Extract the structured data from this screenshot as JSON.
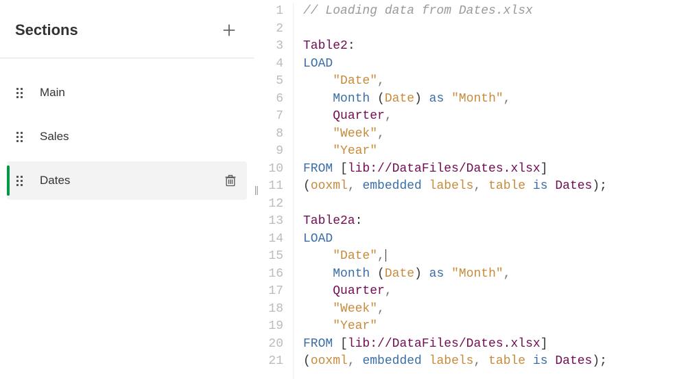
{
  "sidebar": {
    "title": "Sections",
    "items": [
      {
        "label": "Main",
        "active": false
      },
      {
        "label": "Sales",
        "active": false
      },
      {
        "label": "Dates",
        "active": true
      }
    ]
  },
  "editor": {
    "lines": [
      {
        "n": 1,
        "tokens": [
          {
            "t": "// Loading data from Dates.xlsx",
            "c": "c-comment"
          }
        ]
      },
      {
        "n": 2,
        "tokens": []
      },
      {
        "n": 3,
        "tokens": [
          {
            "t": "Table2",
            "c": "c-ident"
          },
          {
            "t": ":",
            "c": "c-black"
          }
        ]
      },
      {
        "n": 4,
        "tokens": [
          {
            "t": "LOAD",
            "c": "c-key"
          }
        ]
      },
      {
        "n": 5,
        "tokens": [
          {
            "t": "    ",
            "c": ""
          },
          {
            "t": "\"Date\"",
            "c": "c-str"
          },
          {
            "t": ",",
            "c": "c-punc"
          }
        ]
      },
      {
        "n": 6,
        "tokens": [
          {
            "t": "    ",
            "c": ""
          },
          {
            "t": "Month",
            "c": "c-key"
          },
          {
            "t": " (",
            "c": "c-black"
          },
          {
            "t": "Date",
            "c": "c-str"
          },
          {
            "t": ") ",
            "c": "c-black"
          },
          {
            "t": "as",
            "c": "c-key"
          },
          {
            "t": " ",
            "c": ""
          },
          {
            "t": "\"Month\"",
            "c": "c-str"
          },
          {
            "t": ",",
            "c": "c-punc"
          }
        ]
      },
      {
        "n": 7,
        "tokens": [
          {
            "t": "    ",
            "c": ""
          },
          {
            "t": "Quarter",
            "c": "c-ident"
          },
          {
            "t": ",",
            "c": "c-punc"
          }
        ]
      },
      {
        "n": 8,
        "tokens": [
          {
            "t": "    ",
            "c": ""
          },
          {
            "t": "\"Week\"",
            "c": "c-str"
          },
          {
            "t": ",",
            "c": "c-punc"
          }
        ]
      },
      {
        "n": 9,
        "tokens": [
          {
            "t": "    ",
            "c": ""
          },
          {
            "t": "\"Year\"",
            "c": "c-str"
          }
        ]
      },
      {
        "n": 10,
        "tokens": [
          {
            "t": "FROM",
            "c": "c-key"
          },
          {
            "t": " [",
            "c": "c-black"
          },
          {
            "t": "lib://DataFiles/Dates.xlsx",
            "c": "c-ident"
          },
          {
            "t": "]",
            "c": "c-black"
          }
        ]
      },
      {
        "n": 11,
        "tokens": [
          {
            "t": "(",
            "c": "c-black"
          },
          {
            "t": "ooxml",
            "c": "c-str"
          },
          {
            "t": ", ",
            "c": "c-punc"
          },
          {
            "t": "embedded",
            "c": "c-key"
          },
          {
            "t": " ",
            "c": ""
          },
          {
            "t": "labels",
            "c": "c-str"
          },
          {
            "t": ", ",
            "c": "c-punc"
          },
          {
            "t": "table",
            "c": "c-str"
          },
          {
            "t": " ",
            "c": ""
          },
          {
            "t": "is",
            "c": "c-key"
          },
          {
            "t": " ",
            "c": ""
          },
          {
            "t": "Dates",
            "c": "c-ident"
          },
          {
            "t": ");",
            "c": "c-black"
          }
        ]
      },
      {
        "n": 12,
        "tokens": []
      },
      {
        "n": 13,
        "tokens": [
          {
            "t": "Table2a",
            "c": "c-ident"
          },
          {
            "t": ":",
            "c": "c-black"
          }
        ]
      },
      {
        "n": 14,
        "tokens": [
          {
            "t": "LOAD",
            "c": "c-key"
          }
        ]
      },
      {
        "n": 15,
        "tokens": [
          {
            "t": "    ",
            "c": ""
          },
          {
            "t": "\"Date\"",
            "c": "c-str"
          },
          {
            "t": ",",
            "c": "c-punc",
            "cursor": true
          }
        ]
      },
      {
        "n": 16,
        "tokens": [
          {
            "t": "    ",
            "c": ""
          },
          {
            "t": "Month",
            "c": "c-key"
          },
          {
            "t": " (",
            "c": "c-black"
          },
          {
            "t": "Date",
            "c": "c-str"
          },
          {
            "t": ") ",
            "c": "c-black"
          },
          {
            "t": "as",
            "c": "c-key"
          },
          {
            "t": " ",
            "c": ""
          },
          {
            "t": "\"Month\"",
            "c": "c-str"
          },
          {
            "t": ",",
            "c": "c-punc"
          }
        ]
      },
      {
        "n": 17,
        "tokens": [
          {
            "t": "    ",
            "c": ""
          },
          {
            "t": "Quarter",
            "c": "c-ident"
          },
          {
            "t": ",",
            "c": "c-punc"
          }
        ]
      },
      {
        "n": 18,
        "tokens": [
          {
            "t": "    ",
            "c": ""
          },
          {
            "t": "\"Week\"",
            "c": "c-str"
          },
          {
            "t": ",",
            "c": "c-punc"
          }
        ]
      },
      {
        "n": 19,
        "tokens": [
          {
            "t": "    ",
            "c": ""
          },
          {
            "t": "\"Year\"",
            "c": "c-str"
          }
        ]
      },
      {
        "n": 20,
        "tokens": [
          {
            "t": "FROM",
            "c": "c-key"
          },
          {
            "t": " [",
            "c": "c-black"
          },
          {
            "t": "lib://DataFiles/Dates.xlsx",
            "c": "c-ident"
          },
          {
            "t": "]",
            "c": "c-black"
          }
        ]
      },
      {
        "n": 21,
        "tokens": [
          {
            "t": "(",
            "c": "c-black"
          },
          {
            "t": "ooxml",
            "c": "c-str"
          },
          {
            "t": ", ",
            "c": "c-punc"
          },
          {
            "t": "embedded",
            "c": "c-key"
          },
          {
            "t": " ",
            "c": ""
          },
          {
            "t": "labels",
            "c": "c-str"
          },
          {
            "t": ", ",
            "c": "c-punc"
          },
          {
            "t": "table",
            "c": "c-str"
          },
          {
            "t": " ",
            "c": ""
          },
          {
            "t": "is",
            "c": "c-key"
          },
          {
            "t": " ",
            "c": ""
          },
          {
            "t": "Dates",
            "c": "c-ident"
          },
          {
            "t": ");",
            "c": "c-black"
          }
        ]
      }
    ]
  }
}
